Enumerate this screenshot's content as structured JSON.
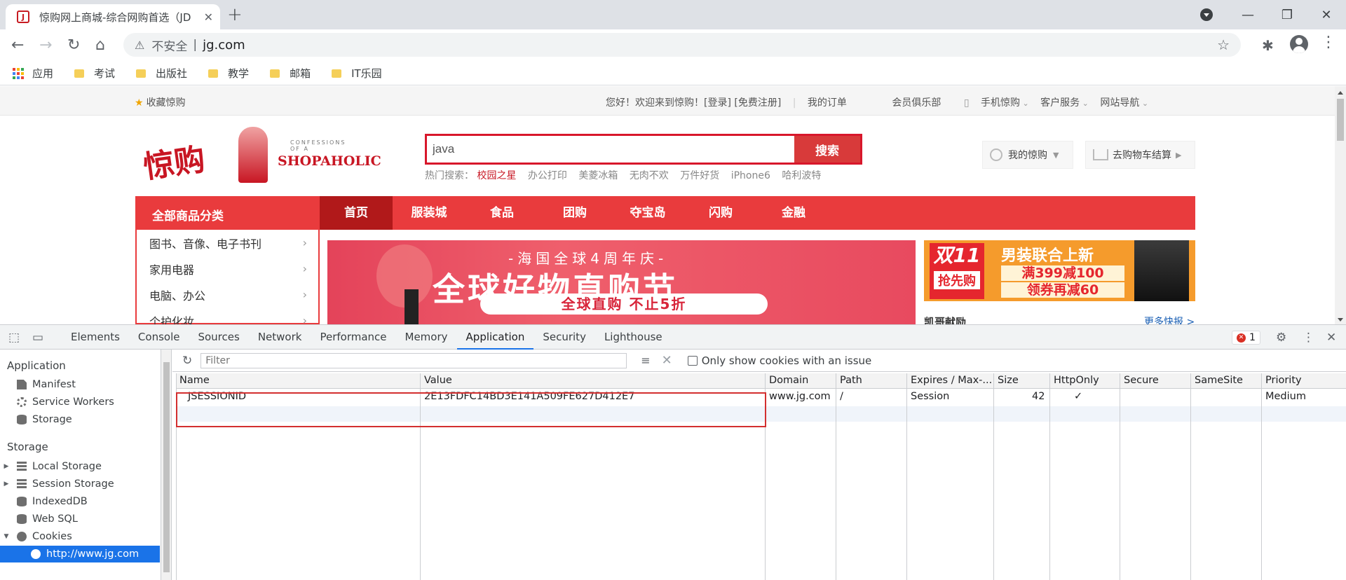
{
  "browser": {
    "tab_title": "惊购网上商城-综合网购首选（JD",
    "tab_close": "✕",
    "newtab": "+",
    "window_controls": [
      "—",
      "❐",
      "✕"
    ],
    "security_label": "不安全",
    "url": "jg.com",
    "bookmarks": [
      "应用",
      "考试",
      "出版社",
      "教学",
      "邮箱",
      "IT乐园"
    ]
  },
  "page": {
    "favorite": "收藏惊购",
    "top_links": [
      "您好！欢迎来到惊购！[登录] [免费注册]",
      "我的订单",
      "会员俱乐部",
      "手机惊购",
      "客户服务",
      "网站导航"
    ],
    "logo_text": "惊购",
    "logo_brand": "SHOPAHOLIC",
    "logo_tagline": "CONFESSIONS OF A",
    "search_value": "java",
    "search_button": "搜索",
    "hot_label": "热门搜索：",
    "hot_words": [
      "校园之星",
      "办公打印",
      "美菱冰箱",
      "无肉不欢",
      "万件好货",
      "iPhone6",
      "哈利波特"
    ],
    "my_account": "我的惊购",
    "cart": "去购物车结算",
    "category_all": "全部商品分类",
    "nav": [
      "首页",
      "服装城",
      "食品",
      "团购",
      "夺宝岛",
      "闪购",
      "金融"
    ],
    "categories": [
      "图书、音像、电子书刊",
      "家用电器",
      "电脑、办公",
      "个护化妆"
    ],
    "banner": {
      "sub": "-海国全球4周年庆-",
      "main": "全球好物直购节",
      "pill": "全球直购 不止5折"
    },
    "ad2": {
      "d11": "双11",
      "qiang": "抢先购",
      "title": "男装联合上新",
      "line1": "满399减100",
      "line2": "领券再减60"
    },
    "news_title": "凯哥献励",
    "news_more": "更多快报 >"
  },
  "devtools": {
    "tabs": [
      "Elements",
      "Console",
      "Sources",
      "Network",
      "Performance",
      "Memory",
      "Application",
      "Security",
      "Lighthouse"
    ],
    "active_tab": "Application",
    "error_count": "1",
    "sidebar": {
      "application_head": "Application",
      "application_items": [
        "Manifest",
        "Service Workers",
        "Storage"
      ],
      "storage_head": "Storage",
      "storage_items": [
        "Local Storage",
        "Session Storage",
        "IndexedDB",
        "Web SQL",
        "Cookies"
      ],
      "selected": "http://www.jg.com"
    },
    "filter_placeholder": "Filter",
    "issue_label": "Only show cookies with an issue",
    "columns": [
      "Name",
      "Value",
      "Domain",
      "Path",
      "Expires / Max-...",
      "Size",
      "HttpOnly",
      "Secure",
      "SameSite",
      "Priority"
    ],
    "cookie": {
      "name": "JSESSIONID",
      "value": "2E13FDFC14BD3E141A509FE627D412E7",
      "domain": "www.jg.com",
      "path": "/",
      "expires": "Session",
      "size": "42",
      "httponly": "✓",
      "secure": "",
      "samesite": "",
      "priority": "Medium"
    }
  }
}
